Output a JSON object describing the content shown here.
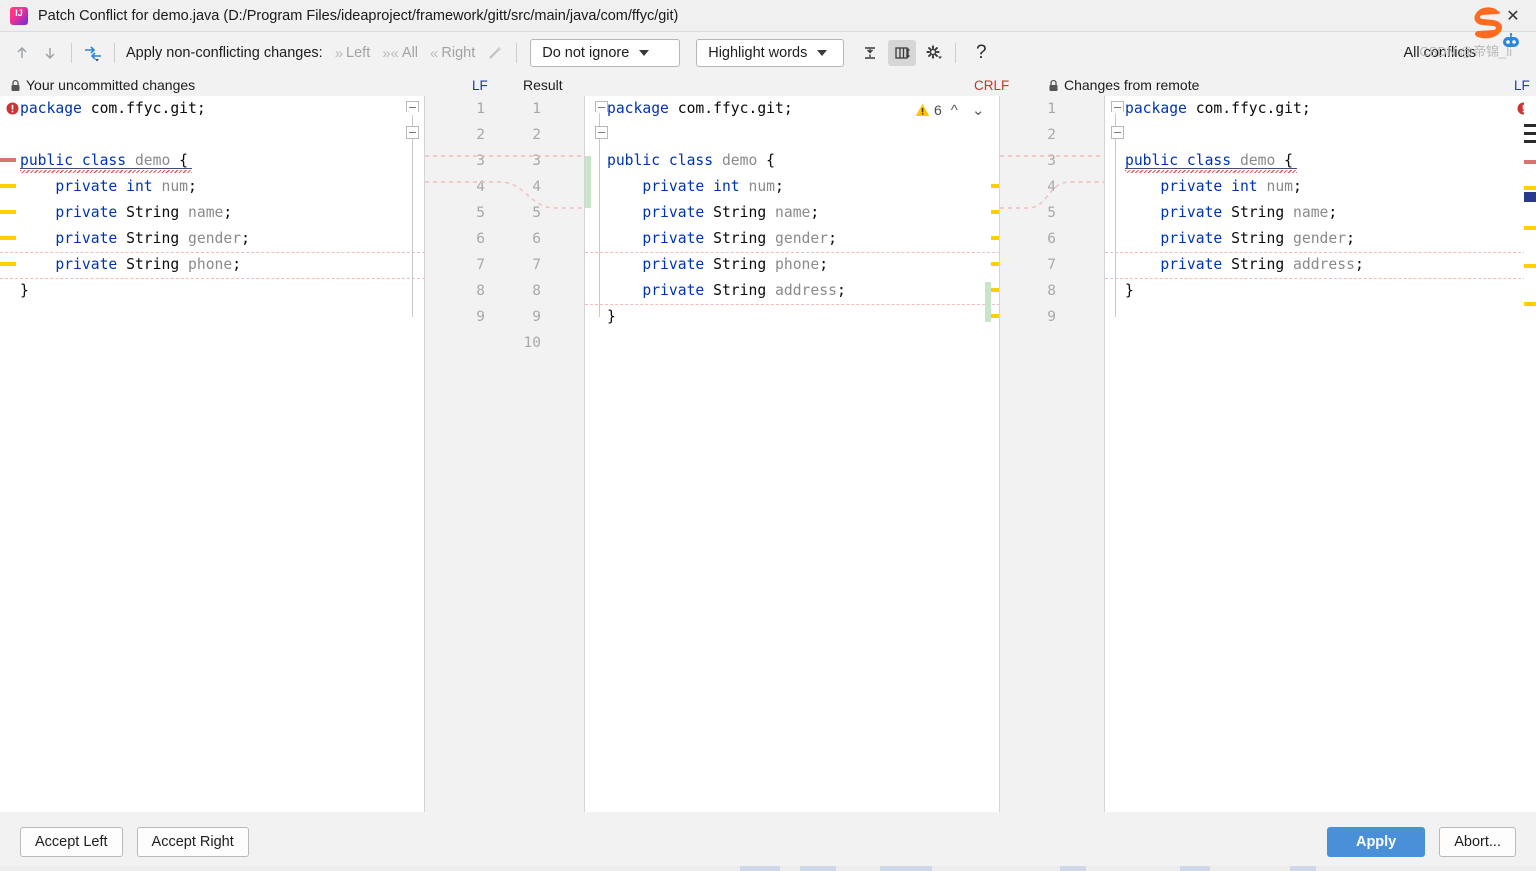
{
  "window": {
    "title": "Patch Conflict for demo.java (D:/Program Files/ideaproject/framework/gitt/src/main/java/com/ffyc/git)",
    "app_icon": "intellij-idea-icon",
    "close_label": "✕"
  },
  "toolbar": {
    "prev_label": "↑",
    "next_label": "↓",
    "apply_all_icon": "apply-non-conflicting-icon",
    "apply_label": "Apply non-conflicting changes:",
    "left_label": "Left",
    "all_label": "All",
    "right_label": "Right",
    "magic_icon": "magic-resolve-icon",
    "ignore_policy": "Do not ignore",
    "highlight_policy": "Highlight words",
    "collapse_icon": "collapse-unchanged-icon",
    "columns_icon": "editor-layout-icon",
    "settings_icon": "gear-icon",
    "help_icon": "?",
    "all_conflicts_label": "All conflicts",
    "robot_icon": "robot-icon",
    "sogou_icon": "sogou-logo-icon"
  },
  "panes": {
    "left": {
      "title": "Your uncommitted changes",
      "lock_icon": "lock-icon",
      "eol": "LF",
      "eol_color": "#2233cc",
      "error_icon": "error-icon",
      "lines": [
        {
          "n": 1,
          "tokens": [
            {
              "t": "package",
              "c": "kw"
            },
            {
              "t": " com.ffyc.git;",
              "c": "ty"
            }
          ]
        },
        {
          "n": 2,
          "tokens": []
        },
        {
          "n": 3,
          "tokens": [
            {
              "t": "public",
              "c": "kw"
            },
            {
              "t": " ",
              "c": "ty"
            },
            {
              "t": "class",
              "c": "kw"
            },
            {
              "t": " ",
              "c": "ty"
            },
            {
              "t": "demo",
              "c": "id"
            },
            {
              "t": " {",
              "c": "ty"
            }
          ]
        },
        {
          "n": 4,
          "tokens": [
            {
              "t": "    ",
              "c": "ty"
            },
            {
              "t": "private",
              "c": "kw"
            },
            {
              "t": " ",
              "c": "ty"
            },
            {
              "t": "int",
              "c": "kw"
            },
            {
              "t": " ",
              "c": "ty"
            },
            {
              "t": "num",
              "c": "id"
            },
            {
              "t": ";",
              "c": "ty"
            }
          ]
        },
        {
          "n": 5,
          "tokens": [
            {
              "t": "    ",
              "c": "ty"
            },
            {
              "t": "private",
              "c": "kw"
            },
            {
              "t": " String ",
              "c": "ty"
            },
            {
              "t": "name",
              "c": "id"
            },
            {
              "t": ";",
              "c": "ty"
            }
          ]
        },
        {
          "n": 6,
          "tokens": [
            {
              "t": "    ",
              "c": "ty"
            },
            {
              "t": "private",
              "c": "kw"
            },
            {
              "t": " String ",
              "c": "ty"
            },
            {
              "t": "gender",
              "c": "id"
            },
            {
              "t": ";",
              "c": "ty"
            }
          ]
        },
        {
          "n": 7,
          "tokens": [
            {
              "t": "    ",
              "c": "ty"
            },
            {
              "t": "private",
              "c": "kw"
            },
            {
              "t": " String ",
              "c": "ty"
            },
            {
              "t": "phone",
              "c": "id"
            },
            {
              "t": ";",
              "c": "ty"
            }
          ]
        },
        {
          "n": 8,
          "tokens": [
            {
              "t": "}",
              "c": "ty"
            }
          ]
        },
        {
          "n": 9,
          "tokens": []
        }
      ],
      "line_numbers": [
        1,
        2,
        3,
        4,
        5,
        6,
        7,
        8,
        9
      ]
    },
    "center": {
      "title": "Result",
      "eol": "CRLF",
      "eol_color": "#c8352b",
      "warning_icon": "warning-icon",
      "warning_count": "6",
      "nav_prev_icon": "chevron-up-icon",
      "nav_next_icon": "chevron-down-icon",
      "lines": [
        {
          "n": 1,
          "tokens": [
            {
              "t": "package",
              "c": "kw"
            },
            {
              "t": " com.ffyc.git;",
              "c": "ty"
            }
          ]
        },
        {
          "n": 2,
          "tokens": []
        },
        {
          "n": 3,
          "tokens": [
            {
              "t": "public",
              "c": "kw"
            },
            {
              "t": " ",
              "c": "ty"
            },
            {
              "t": "class",
              "c": "kw"
            },
            {
              "t": " ",
              "c": "ty"
            },
            {
              "t": "demo",
              "c": "id"
            },
            {
              "t": " {",
              "c": "ty"
            }
          ]
        },
        {
          "n": 4,
          "tokens": [
            {
              "t": "    ",
              "c": "ty"
            },
            {
              "t": "private",
              "c": "kw"
            },
            {
              "t": " ",
              "c": "ty"
            },
            {
              "t": "int",
              "c": "kw"
            },
            {
              "t": " ",
              "c": "ty"
            },
            {
              "t": "num",
              "c": "id"
            },
            {
              "t": ";",
              "c": "ty"
            }
          ]
        },
        {
          "n": 5,
          "tokens": [
            {
              "t": "    ",
              "c": "ty"
            },
            {
              "t": "private",
              "c": "kw"
            },
            {
              "t": " String ",
              "c": "ty"
            },
            {
              "t": "name",
              "c": "id"
            },
            {
              "t": ";",
              "c": "ty"
            }
          ]
        },
        {
          "n": 6,
          "tokens": [
            {
              "t": "    ",
              "c": "ty"
            },
            {
              "t": "private",
              "c": "kw"
            },
            {
              "t": " String ",
              "c": "ty"
            },
            {
              "t": "gender",
              "c": "id"
            },
            {
              "t": ";",
              "c": "ty"
            }
          ]
        },
        {
          "n": 7,
          "tokens": [
            {
              "t": "    ",
              "c": "ty"
            },
            {
              "t": "private",
              "c": "kw"
            },
            {
              "t": " String ",
              "c": "ty"
            },
            {
              "t": "phone",
              "c": "id"
            },
            {
              "t": ";",
              "c": "ty"
            }
          ]
        },
        {
          "n": 8,
          "tokens": [
            {
              "t": "    ",
              "c": "ty"
            },
            {
              "t": "private",
              "c": "kw"
            },
            {
              "t": " String ",
              "c": "ty"
            },
            {
              "t": "address",
              "c": "id"
            },
            {
              "t": ";",
              "c": "ty"
            }
          ]
        },
        {
          "n": 9,
          "tokens": [
            {
              "t": "}",
              "c": "ty"
            }
          ]
        },
        {
          "n": 10,
          "tokens": []
        }
      ],
      "line_numbers": [
        1,
        2,
        3,
        4,
        5,
        6,
        7,
        8,
        9,
        10
      ]
    },
    "right": {
      "title": "Changes from remote",
      "lock_icon": "lock-icon",
      "eol": "LF",
      "eol_color": "#2233cc",
      "error_icon": "error-icon",
      "lines": [
        {
          "n": 1,
          "tokens": [
            {
              "t": "package",
              "c": "kw"
            },
            {
              "t": " com.ffyc.git;",
              "c": "ty"
            }
          ]
        },
        {
          "n": 2,
          "tokens": []
        },
        {
          "n": 3,
          "tokens": [
            {
              "t": "public",
              "c": "kw"
            },
            {
              "t": " ",
              "c": "ty"
            },
            {
              "t": "class",
              "c": "kw"
            },
            {
              "t": " ",
              "c": "ty"
            },
            {
              "t": "demo",
              "c": "id"
            },
            {
              "t": " {",
              "c": "ty"
            }
          ]
        },
        {
          "n": 4,
          "tokens": [
            {
              "t": "    ",
              "c": "ty"
            },
            {
              "t": "private",
              "c": "kw"
            },
            {
              "t": " ",
              "c": "ty"
            },
            {
              "t": "int",
              "c": "kw"
            },
            {
              "t": " ",
              "c": "ty"
            },
            {
              "t": "num",
              "c": "id"
            },
            {
              "t": ";",
              "c": "ty"
            }
          ]
        },
        {
          "n": 5,
          "tokens": [
            {
              "t": "    ",
              "c": "ty"
            },
            {
              "t": "private",
              "c": "kw"
            },
            {
              "t": " String ",
              "c": "ty"
            },
            {
              "t": "name",
              "c": "id"
            },
            {
              "t": ";",
              "c": "ty"
            }
          ]
        },
        {
          "n": 6,
          "tokens": [
            {
              "t": "    ",
              "c": "ty"
            },
            {
              "t": "private",
              "c": "kw"
            },
            {
              "t": " String ",
              "c": "ty"
            },
            {
              "t": "gender",
              "c": "id"
            },
            {
              "t": ";",
              "c": "ty"
            }
          ]
        },
        {
          "n": 7,
          "tokens": [
            {
              "t": "    ",
              "c": "ty"
            },
            {
              "t": "private",
              "c": "kw"
            },
            {
              "t": " String ",
              "c": "ty"
            },
            {
              "t": "address",
              "c": "id"
            },
            {
              "t": ";",
              "c": "ty"
            }
          ]
        },
        {
          "n": 8,
          "tokens": [
            {
              "t": "}",
              "c": "ty"
            }
          ]
        },
        {
          "n": 9,
          "tokens": []
        }
      ],
      "line_numbers": [
        1,
        2,
        3,
        4,
        5,
        6,
        7,
        8,
        9
      ]
    }
  },
  "footer": {
    "accept_left": "Accept Left",
    "accept_right": "Accept Right",
    "apply": "Apply",
    "abort": "Abort...",
    "watermark": "CSDN @帝锦_li"
  },
  "colors": {
    "accent": "#4a90d9",
    "keyword": "#0033b3",
    "identifier": "#8a8a8a",
    "warning": "#ffc400",
    "error": "#cc3333",
    "conflict_band": "#f0b6b6",
    "applied_green": "#c7e6c7"
  }
}
